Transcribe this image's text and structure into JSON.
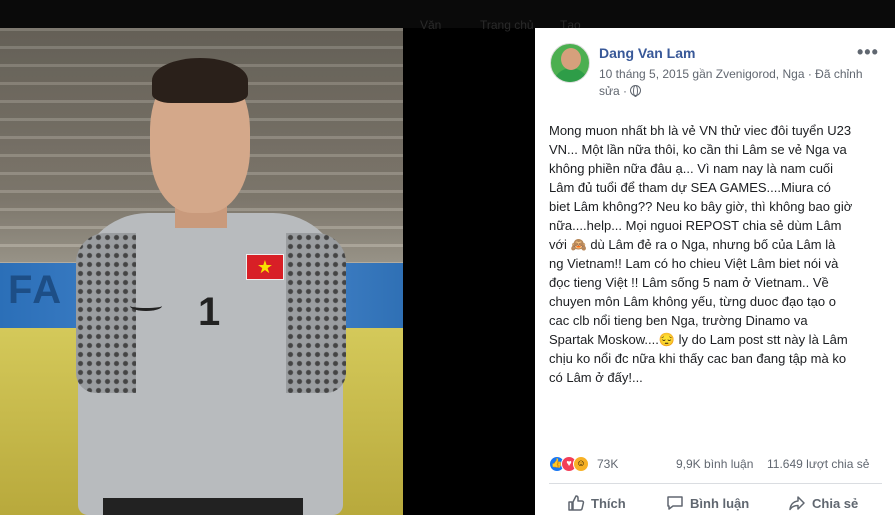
{
  "topbar": {
    "ghost_items": [
      "Văn",
      "Trang chủ",
      "Tạo"
    ]
  },
  "post": {
    "author": "Dang Van Lam",
    "meta_line1": "10 tháng 5, 2015 gần Zvenigorod, Nga · Đã chỉnh",
    "meta_line2": "sửa ·",
    "more_label": "•••",
    "photo_banner_text": "FA",
    "jersey_number": "1",
    "flag_star": "★",
    "text_lines": [
      "Mong muon nhất bh là vẻ VN thử viec đôi tuyển U23",
      "VN... Một lần nữa thôi, ko cần thi Lâm se vẻ Nga va",
      "không phiền nữa đâu ạ... Vì nam nay là nam cuối",
      "Lâm đủ tuổi để tham dự SEA GAMES....Miura có",
      "biet Lâm không?? Neu ko bây giờ, thì không bao giờ",
      "nữa....help... Mọi nguoi REPOST chia sẻ dùm Lâm",
      "với 🙈 dù Lâm đẻ ra o Nga, nhưng bố của Lâm là",
      "ng Vietnam!! Lam có ho chieu Việt Lâm biet nói và",
      "đọc tieng Việt !! Lâm sống 5 nam ở Vietnam.. Về",
      "chuyen môn Lâm không yếu, từng duoc đạo tạo o",
      "cac clb nổi tieng ben Nga, trường Dinamo va",
      "Spartak Moskow....😔 ly do Lam post stt này là Lâm",
      "chịu ko nổi đc nữa khi thấy cac ban đang tập mà ko",
      "có Lâm ở đấy!..."
    ]
  },
  "stats": {
    "reactions_count": "73K",
    "comments": "9,9K bình luận",
    "shares": "11.649 lượt chia sẻ",
    "reaction_icons": [
      "like-icon",
      "love-icon",
      "haha-icon"
    ]
  },
  "actions": {
    "like_label": "Thích",
    "comment_label": "Bình luận",
    "share_label": "Chia sẻ"
  },
  "colors": {
    "author_blue": "#385898",
    "like_blue": "#1877f2",
    "love_red": "#f33e58",
    "haha_yellow": "#f7b125",
    "meta_gray": "#616770"
  }
}
